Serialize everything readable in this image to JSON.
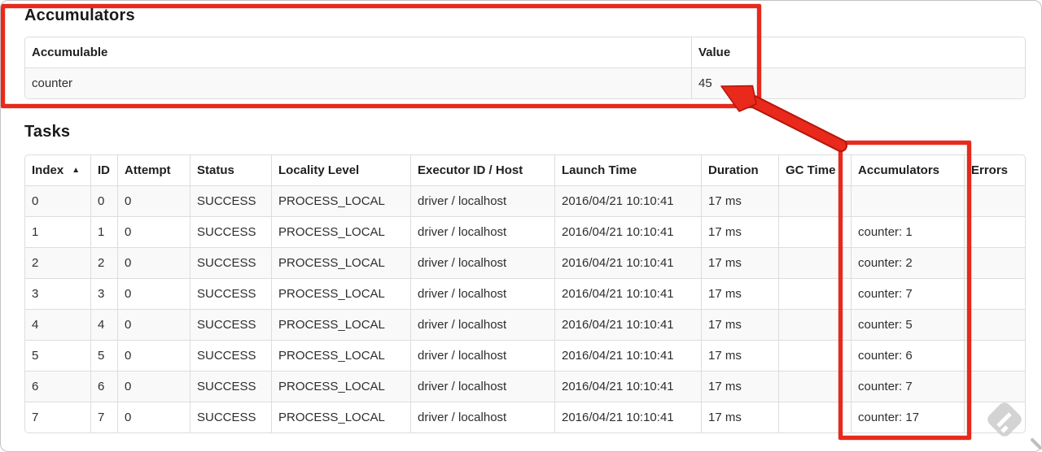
{
  "accumulators_section": {
    "title": "Accumulators",
    "table": {
      "headers": [
        "Accumulable",
        "Value"
      ],
      "rows": [
        [
          "counter",
          "45"
        ]
      ]
    }
  },
  "tasks_section": {
    "title": "Tasks",
    "table": {
      "headers": [
        "Index",
        "ID",
        "Attempt",
        "Status",
        "Locality Level",
        "Executor ID / Host",
        "Launch Time",
        "Duration",
        "GC Time",
        "Accumulators",
        "Errors"
      ],
      "sort_icon": "▲",
      "rows": [
        [
          "0",
          "0",
          "0",
          "SUCCESS",
          "PROCESS_LOCAL",
          "driver / localhost",
          "2016/04/21 10:10:41",
          "17 ms",
          "",
          "",
          ""
        ],
        [
          "1",
          "1",
          "0",
          "SUCCESS",
          "PROCESS_LOCAL",
          "driver / localhost",
          "2016/04/21 10:10:41",
          "17 ms",
          "",
          "counter: 1",
          ""
        ],
        [
          "2",
          "2",
          "0",
          "SUCCESS",
          "PROCESS_LOCAL",
          "driver / localhost",
          "2016/04/21 10:10:41",
          "17 ms",
          "",
          "counter: 2",
          ""
        ],
        [
          "3",
          "3",
          "0",
          "SUCCESS",
          "PROCESS_LOCAL",
          "driver / localhost",
          "2016/04/21 10:10:41",
          "17 ms",
          "",
          "counter: 7",
          ""
        ],
        [
          "4",
          "4",
          "0",
          "SUCCESS",
          "PROCESS_LOCAL",
          "driver / localhost",
          "2016/04/21 10:10:41",
          "17 ms",
          "",
          "counter: 5",
          ""
        ],
        [
          "5",
          "5",
          "0",
          "SUCCESS",
          "PROCESS_LOCAL",
          "driver / localhost",
          "2016/04/21 10:10:41",
          "17 ms",
          "",
          "counter: 6",
          ""
        ],
        [
          "6",
          "6",
          "0",
          "SUCCESS",
          "PROCESS_LOCAL",
          "driver / localhost",
          "2016/04/21 10:10:41",
          "17 ms",
          "",
          "counter: 7",
          ""
        ],
        [
          "7",
          "7",
          "0",
          "SUCCESS",
          "PROCESS_LOCAL",
          "driver / localhost",
          "2016/04/21 10:10:41",
          "17 ms",
          "",
          "counter: 17",
          ""
        ]
      ]
    }
  },
  "annotations": {
    "color": "#e8291c"
  }
}
